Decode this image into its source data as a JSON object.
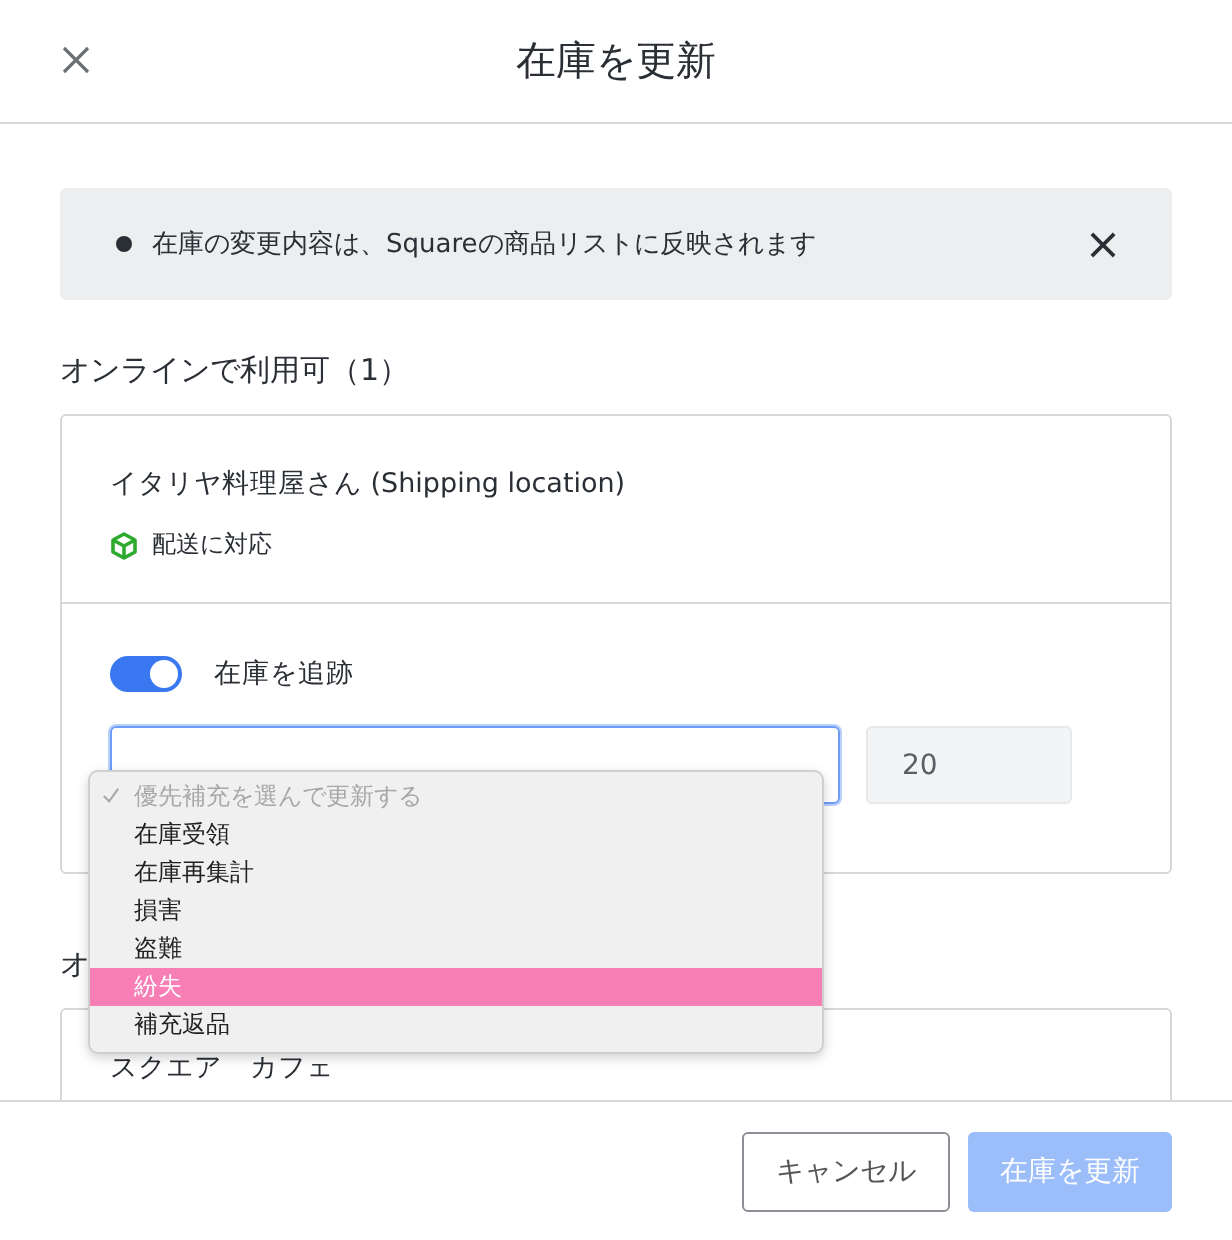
{
  "header": {
    "title": "在庫を更新"
  },
  "notice": {
    "text": "在庫の変更内容は、Squareの商品リストに反映されます"
  },
  "sections": [
    {
      "heading": "オンラインで利用可（1）",
      "location": {
        "name": "イタリヤ料理屋さん (Shipping location)",
        "badge": "配送に対応"
      },
      "track": {
        "label": "在庫を追跡",
        "on": true
      },
      "quantity": "20"
    },
    {
      "heading": "オ",
      "location": {
        "name": "スクエア　カフェ"
      }
    }
  ],
  "dropdown": {
    "options": [
      {
        "label": "優先補充を選んで更新する",
        "kind": "placeholder",
        "selected": false
      },
      {
        "label": "在庫受領",
        "kind": "option",
        "selected": false
      },
      {
        "label": "在庫再集計",
        "kind": "option",
        "selected": false
      },
      {
        "label": "損害",
        "kind": "option",
        "selected": false
      },
      {
        "label": "盗難",
        "kind": "option",
        "selected": false
      },
      {
        "label": "紛失",
        "kind": "option",
        "selected": true
      },
      {
        "label": "補充返品",
        "kind": "option",
        "selected": false
      }
    ]
  },
  "footer": {
    "buttons": [
      {
        "label": "キャンセル",
        "kind": "secondary",
        "disabled": false
      },
      {
        "label": "在庫を更新",
        "kind": "primary",
        "disabled": true
      }
    ]
  }
}
